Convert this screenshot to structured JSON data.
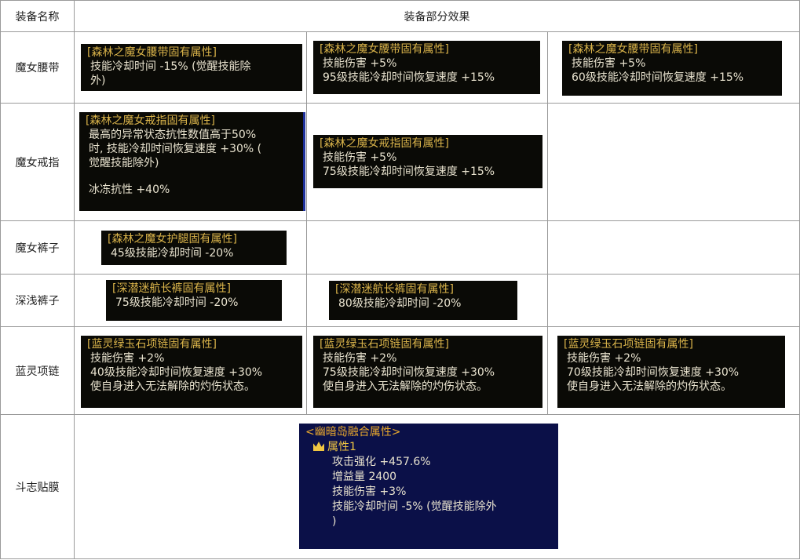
{
  "header": {
    "col_name": "装备名称",
    "col_effect": "装备部分效果"
  },
  "rows": [
    {
      "name": "魔女腰带",
      "tips": [
        {
          "title": "[森林之魔女腰带固有属性]",
          "lines": [
            "技能冷却时间 -15% (觉醒技能除",
            "外)"
          ]
        },
        {
          "title": "[森林之魔女腰带固有属性]",
          "lines": [
            "技能伤害 +5%",
            "95级技能冷却时间恢复速度 +15%"
          ]
        },
        {
          "title": "[森林之魔女腰带固有属性]",
          "lines": [
            "技能伤害 +5%",
            "60级技能冷却时间恢复速度 +15%"
          ]
        }
      ]
    },
    {
      "name": "魔女戒指",
      "tips": [
        {
          "title": "[森林之魔女戒指固有属性]",
          "lines": [
            "最高的异常状态抗性数值高于50%",
            "时, 技能冷却时间恢复速度 +30% (",
            "觉醒技能除外)",
            "冰冻抗性 +40%"
          ]
        },
        {
          "title": "[森林之魔女戒指固有属性]",
          "lines": [
            "技能伤害 +5%",
            "75级技能冷却时间恢复速度 +15%"
          ]
        }
      ]
    },
    {
      "name": "魔女裤子",
      "tips": [
        {
          "title": "[森林之魔女护腿固有属性]",
          "lines": [
            "45级技能冷却时间 -20%"
          ]
        }
      ]
    },
    {
      "name": "深浅裤子",
      "tips": [
        {
          "title": "[深潜迷航长裤固有属性]",
          "lines": [
            "75级技能冷却时间 -20%"
          ]
        },
        {
          "title": "[深潜迷航长裤固有属性]",
          "lines": [
            "80级技能冷却时间 -20%"
          ]
        }
      ]
    },
    {
      "name": "蓝灵项链",
      "tips": [
        {
          "title": "[蓝灵绿玉石项链固有属性]",
          "lines": [
            "技能伤害 +2%",
            "40级技能冷却时间恢复速度 +30%",
            "使自身进入无法解除的灼伤状态。"
          ]
        },
        {
          "title": "[蓝灵绿玉石项链固有属性]",
          "lines": [
            "技能伤害 +2%",
            "75级技能冷却时间恢复速度 +30%",
            "使自身进入无法解除的灼伤状态。"
          ]
        },
        {
          "title": "[蓝灵绿玉石项链固有属性]",
          "lines": [
            "技能伤害 +2%",
            "70级技能冷却时间恢复速度 +30%",
            "使自身进入无法解除的灼伤状态。"
          ]
        }
      ]
    },
    {
      "name": "斗志贴膜",
      "tips": [
        {
          "title": "<幽暗岛融合属性>",
          "sub": "属性1",
          "lines": [
            "攻击强化 +457.6%",
            "增益量 2400",
            "技能伤害 +3%",
            "技能冷却时间 -5% (觉醒技能除外",
            ")"
          ]
        }
      ]
    }
  ]
}
